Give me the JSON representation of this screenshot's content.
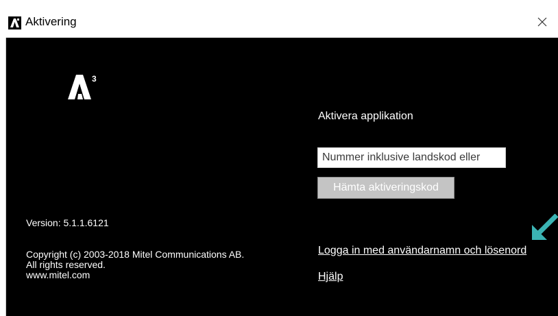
{
  "window": {
    "title": "Aktivering",
    "close_symbol": "✕",
    "app_icon": "a3-logo-icon"
  },
  "left_panel": {
    "version": "Version: 5.1.1.6121",
    "copyright_lines": [
      "Copyright (c) 2003-2018 Mitel Communications AB.",
      "All rights reserved.",
      "www.mitel.com"
    ]
  },
  "right_panel": {
    "heading": "Aktivera applikation",
    "phone_placeholder": "Nummer inklusive landskod eller",
    "fetch_button": "Hämta aktiveringskod",
    "login_link": "Logga in med användarnamn och lösenord",
    "help_link": "Hjälp"
  },
  "colors": {
    "background": "#000000",
    "text": "#ffffff",
    "button_disabled": "#c4c4c4",
    "arrow": "#3bb3b3"
  },
  "annotation_icon": "teal-arrow-icon"
}
